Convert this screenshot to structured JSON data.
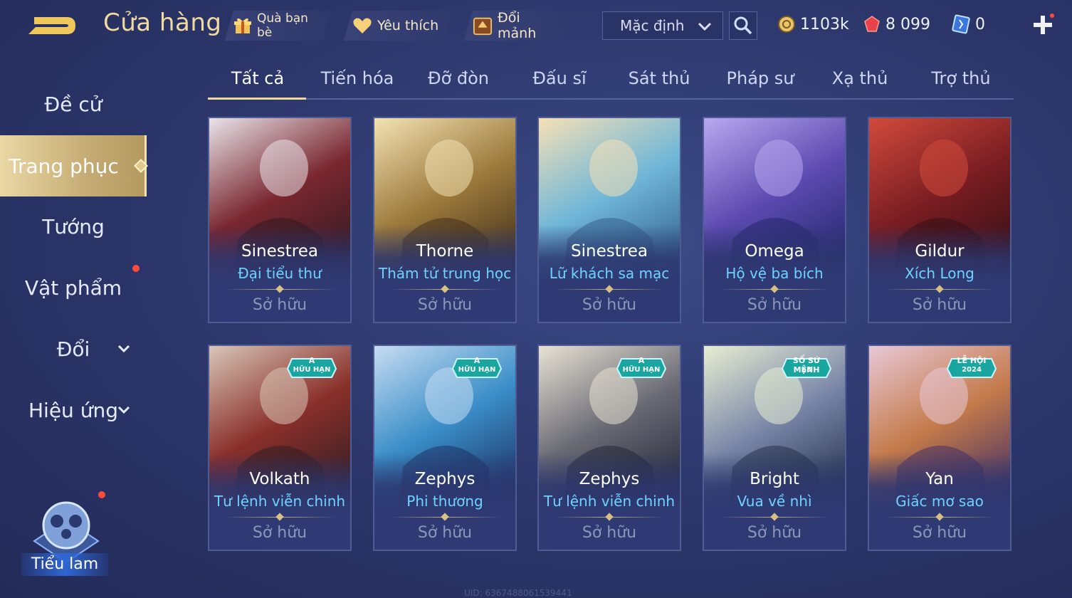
{
  "header": {
    "title": "Cửa hàng",
    "friend_gift": "Quà bạn bè",
    "favorites": "Yêu thích",
    "exchange_shards": "Đổi mảnh",
    "sort": {
      "selected": "Mặc định"
    },
    "currencies": {
      "gold": "1103k",
      "ruby": "8 099",
      "voucher": "0"
    }
  },
  "sidebar": {
    "items": [
      {
        "label": "Đề cử"
      },
      {
        "label": "Trang phục"
      },
      {
        "label": "Tướng"
      },
      {
        "label": "Vật phẩm"
      },
      {
        "label": "Đổi"
      },
      {
        "label": "Hiệu ứng"
      }
    ],
    "mascot_label": "Tiểu lam"
  },
  "tabs": [
    {
      "label": "Tất cả"
    },
    {
      "label": "Tiến hóa"
    },
    {
      "label": "Đỡ đòn"
    },
    {
      "label": "Đấu sĩ"
    },
    {
      "label": "Sát thủ"
    },
    {
      "label": "Pháp sư"
    },
    {
      "label": "Xạ thủ"
    },
    {
      "label": "Trợ thủ"
    }
  ],
  "cards": [
    {
      "hero": "Sinestrea",
      "skin": "Đại tiểu thư",
      "status": "Sở hữu",
      "art": [
        "#e9e4ea",
        "#7a2730",
        "#2a1820"
      ]
    },
    {
      "hero": "Thorne",
      "skin": "Thám tử trung học",
      "status": "Sở hữu",
      "art": [
        "#f3e2b4",
        "#9c7a3c",
        "#3d2a18"
      ]
    },
    {
      "hero": "Sinestrea",
      "skin": "Lữ khách sa mạc",
      "status": "Sở hữu",
      "art": [
        "#f6e0b6",
        "#6fb6d8",
        "#2f5a86"
      ]
    },
    {
      "hero": "Omega",
      "skin": "Hộ vệ ba bích",
      "status": "Sở hữu",
      "art": [
        "#b9a8f0",
        "#5c4ab0",
        "#1f2466"
      ]
    },
    {
      "hero": "Gildur",
      "skin": "Xích Long",
      "status": "Sở hữu",
      "art": [
        "#d24a3c",
        "#7a1d22",
        "#2d0e14"
      ]
    },
    {
      "hero": "Volkath",
      "skin": "Tư lệnh viễn chinh",
      "status": "Sở hữu",
      "badge": [
        "A",
        "HỮU HẠN"
      ],
      "art": [
        "#d8c6b8",
        "#8a2f2a",
        "#2a1c22"
      ]
    },
    {
      "hero": "Zephys",
      "skin": "Phi thương",
      "status": "Sở hữu",
      "badge": [
        "A",
        "HỮU HẠN"
      ],
      "art": [
        "#c7dcf2",
        "#3a8ec8",
        "#1c2a5c"
      ]
    },
    {
      "hero": "Zephys",
      "skin": "Tư lệnh viễn chinh",
      "status": "Sở hữu",
      "badge": [
        "A",
        "HỮU HẠN"
      ],
      "art": [
        "#e8e2d4",
        "#6a6a74",
        "#1e2236"
      ]
    },
    {
      "hero": "Bright",
      "skin": "Vua về nhì",
      "status": "Sở hữu",
      "badge": [
        "SỔ SỨ MỆNH",
        "63"
      ],
      "art": [
        "#e8eed2",
        "#7a86a8",
        "#1e2a44"
      ]
    },
    {
      "hero": "Yan",
      "skin": "Giấc mơ sao",
      "status": "Sở hữu",
      "badge": [
        "LỄ HỘI",
        "2024"
      ],
      "art": [
        "#e8c8d8",
        "#c47a4a",
        "#3a2a66"
      ]
    }
  ],
  "footer": {
    "uid": "UID: 6367488061539441"
  },
  "colors": {
    "accent_gold": "#f0d99a",
    "skin_name": "#6fd2ff",
    "owned_text": "#8d95b8",
    "alert_dot": "#ff4a3c"
  }
}
